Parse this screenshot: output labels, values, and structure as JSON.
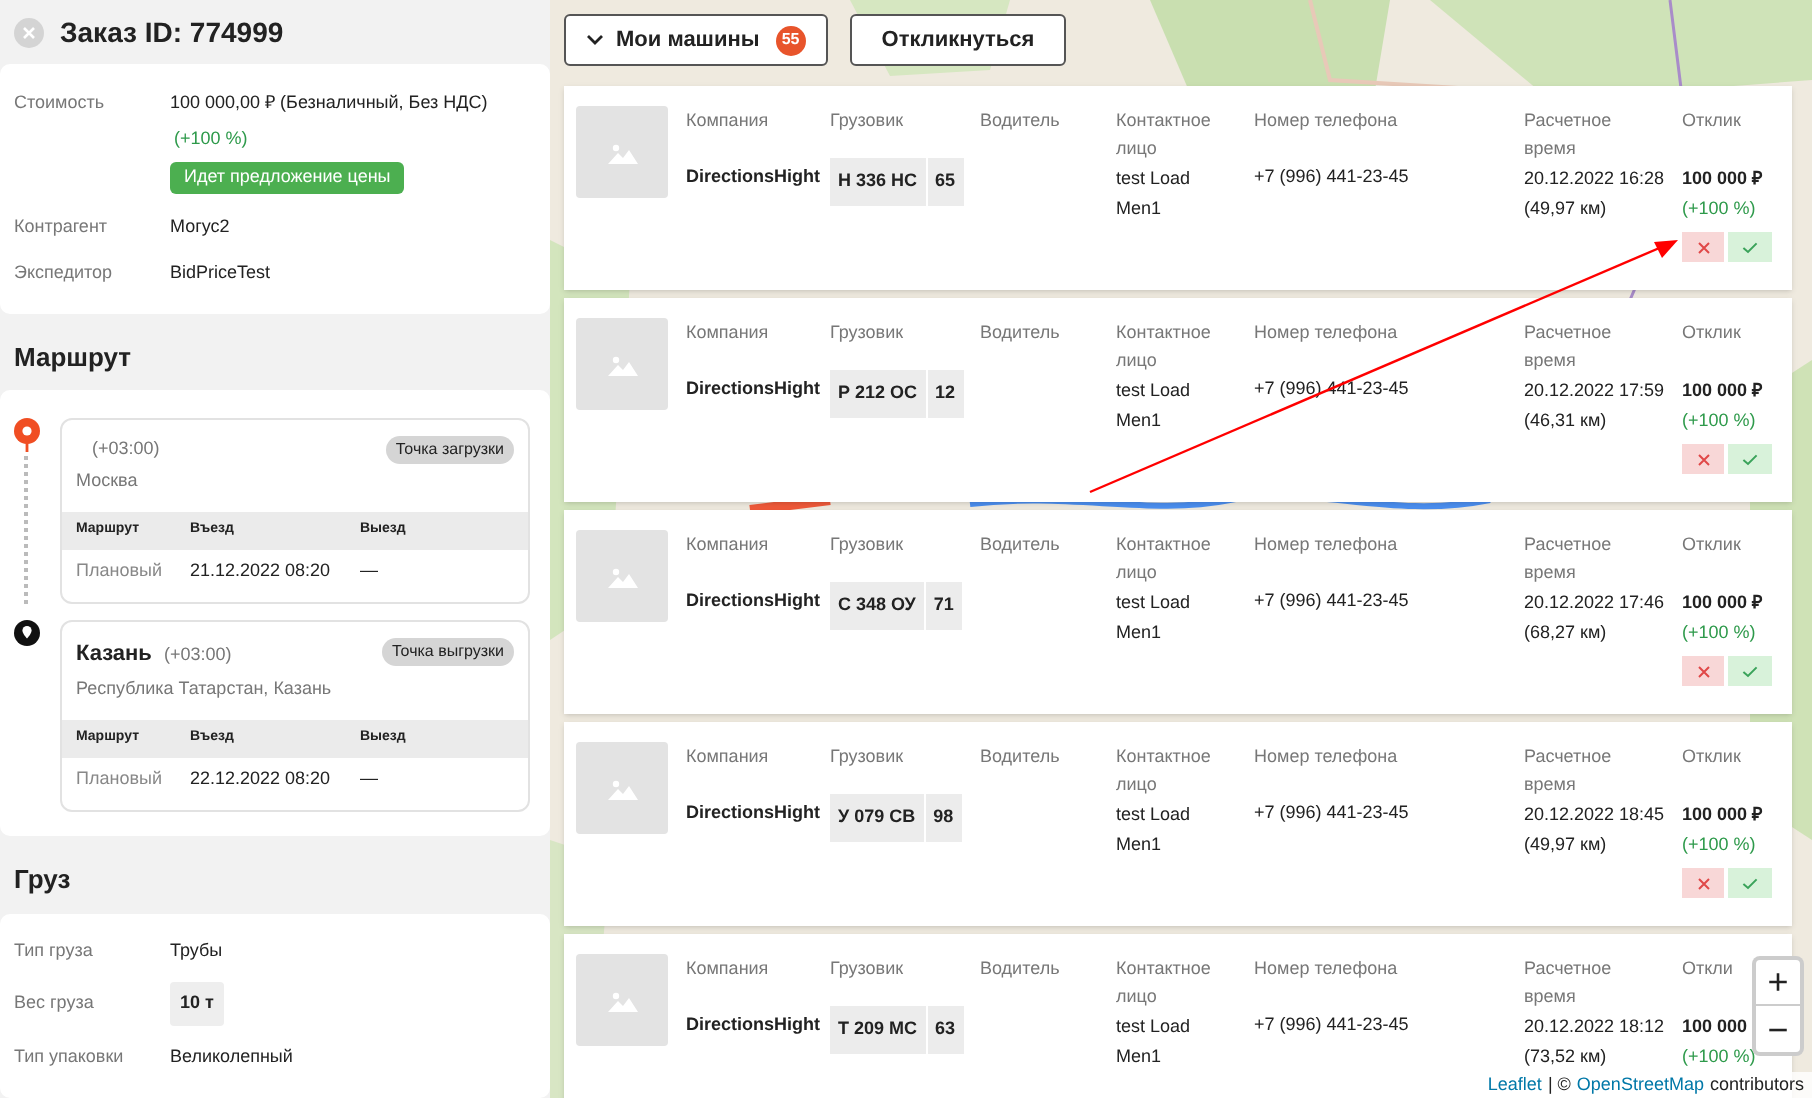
{
  "order": {
    "title": "Заказ ID: 774999",
    "info": [
      {
        "label": "Стоимость",
        "value": "100 000,00 ₽ (Безналичный, Без НДС)",
        "note": "(+100 %)",
        "badge": "Идет предложение цены"
      },
      {
        "label": "Контрагент",
        "value": "Могус2"
      },
      {
        "label": "Экспедитор",
        "value": "BidPriceTest"
      }
    ]
  },
  "route": {
    "title": "Маршрут",
    "stops": [
      {
        "kind": "load",
        "tz": "(+03:00)",
        "address": "Москва",
        "tag": "Точка загрузки",
        "headers": [
          "Маршрут",
          "Въезд",
          "Выезд"
        ],
        "row": [
          "Плановый",
          "21.12.2022 08:20",
          "—"
        ]
      },
      {
        "kind": "unload",
        "city": "Казань",
        "tz": "(+03:00)",
        "address": "Республика Татарстан, Казань",
        "tag": "Точка выгрузки",
        "headers": [
          "Маршрут",
          "Въезд",
          "Выезд"
        ],
        "row": [
          "Плановый",
          "22.12.2022 08:20",
          "—"
        ]
      }
    ]
  },
  "cargo": {
    "title": "Груз",
    "rows": [
      {
        "label": "Тип груза",
        "value": "Трубы"
      },
      {
        "label": "Вес груза",
        "value": "10 т",
        "kind": "chip"
      },
      {
        "label": "Тип упаковки",
        "value": "Великолепный"
      }
    ]
  },
  "toolbar": {
    "vehicles": "Мои машины",
    "count": "55",
    "respond": "Откликнуться"
  },
  "offers": [
    {
      "headers": [
        "Компания",
        "Грузовик",
        "Водитель",
        "Контактное лицо",
        "Номер телефона",
        "Расчетное время",
        "Отклик"
      ],
      "company": "DirectionsHight",
      "plate": "Н 336 НС",
      "region": "65",
      "contact": "test Load Men1",
      "phone": "+7 (996) 441-23-45",
      "time": "20.12.2022 16:28",
      "distance": "(49,97 км)",
      "price": "100 000 ₽",
      "percent": "(+100 %)",
      "actions": true
    },
    {
      "headers": [
        "Компания",
        "Грузовик",
        "Водитель",
        "Контактное лицо",
        "Номер телефона",
        "Расчетное время",
        "Отклик"
      ],
      "company": "DirectionsHight",
      "plate": "Р 212 ОС",
      "region": "12",
      "contact": "test Load Men1",
      "phone": "+7 (996) 441-23-45",
      "time": "20.12.2022 17:59",
      "distance": "(46,31 км)",
      "price": "100 000 ₽",
      "percent": "(+100 %)",
      "actions": true
    },
    {
      "headers": [
        "Компания",
        "Грузовик",
        "Водитель",
        "Контактное лицо",
        "Номер телефона",
        "Расчетное время",
        "Отклик"
      ],
      "company": "DirectionsHight",
      "plate": "С 348 ОУ",
      "region": "71",
      "contact": "test Load Men1",
      "phone": "+7 (996) 441-23-45",
      "time": "20.12.2022 17:46",
      "distance": "(68,27 км)",
      "price": "100 000 ₽",
      "percent": "(+100 %)",
      "actions": true
    },
    {
      "headers": [
        "Компания",
        "Грузовик",
        "Водитель",
        "Контактное лицо",
        "Номер телефона",
        "Расчетное время",
        "Отклик"
      ],
      "company": "DirectionsHight",
      "plate": "У 079 СВ",
      "region": "98",
      "contact": "test Load Men1",
      "phone": "+7 (996) 441-23-45",
      "time": "20.12.2022 18:45",
      "distance": "(49,97 км)",
      "price": "100 000 ₽",
      "percent": "(+100 %)",
      "actions": true
    },
    {
      "headers": [
        "Компания",
        "Грузовик",
        "Водитель",
        "Контактное лицо",
        "Номер телефона",
        "Расчетное время",
        "Откли"
      ],
      "company": "DirectionsHight",
      "plate": "Т 209 МС",
      "region": "63",
      "contact": "test Load Men1",
      "phone": "+7 (996) 441-23-45",
      "time": "20.12.2022 18:12",
      "distance": "(73,52 км)",
      "price": "100 000",
      "percent": "(+100 %)",
      "actions": false
    }
  ],
  "map": {
    "zoom_in": "+",
    "zoom_out": "−",
    "attribution_link": "Leaflet",
    "attribution_sep": "| ©",
    "attribution_osm": "OpenStreetMap",
    "attribution_tail": "contributors"
  }
}
